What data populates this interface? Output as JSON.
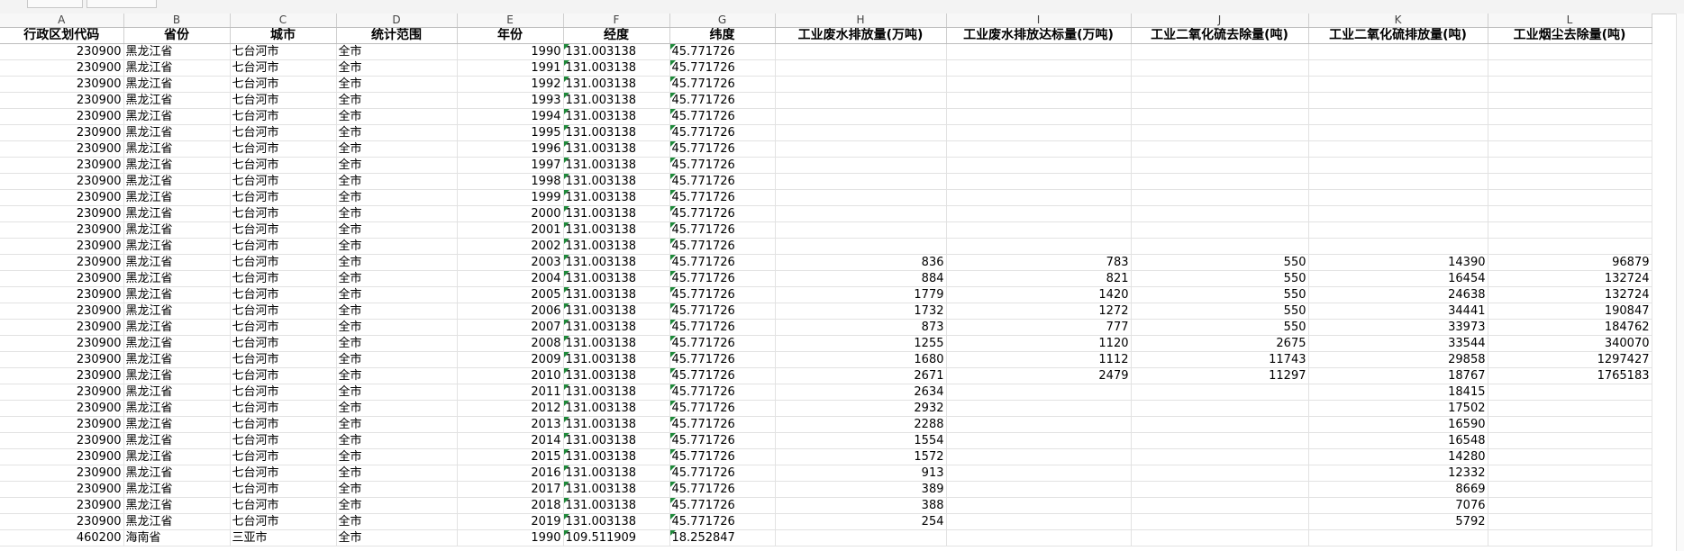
{
  "column_letters": [
    "A",
    "B",
    "C",
    "D",
    "E",
    "F",
    "G",
    "H",
    "I",
    "J",
    "K",
    "L"
  ],
  "headers": [
    "行政区划代码",
    "省份",
    "城市",
    "统计范围",
    "年份",
    "经度",
    "纬度",
    "工业废水排放量(万吨)",
    "工业废水排放达标量(万吨)",
    "工业二氧化硫去除量(吨)",
    "工业二氧化硫排放量(吨)",
    "工业烟尘去除量(吨)"
  ],
  "rows": [
    [
      "230900",
      "黑龙江省",
      "七台河市",
      "全市",
      "1990",
      "131.003138",
      "45.771726",
      "",
      "",
      "",
      "",
      ""
    ],
    [
      "230900",
      "黑龙江省",
      "七台河市",
      "全市",
      "1991",
      "131.003138",
      "45.771726",
      "",
      "",
      "",
      "",
      ""
    ],
    [
      "230900",
      "黑龙江省",
      "七台河市",
      "全市",
      "1992",
      "131.003138",
      "45.771726",
      "",
      "",
      "",
      "",
      ""
    ],
    [
      "230900",
      "黑龙江省",
      "七台河市",
      "全市",
      "1993",
      "131.003138",
      "45.771726",
      "",
      "",
      "",
      "",
      ""
    ],
    [
      "230900",
      "黑龙江省",
      "七台河市",
      "全市",
      "1994",
      "131.003138",
      "45.771726",
      "",
      "",
      "",
      "",
      ""
    ],
    [
      "230900",
      "黑龙江省",
      "七台河市",
      "全市",
      "1995",
      "131.003138",
      "45.771726",
      "",
      "",
      "",
      "",
      ""
    ],
    [
      "230900",
      "黑龙江省",
      "七台河市",
      "全市",
      "1996",
      "131.003138",
      "45.771726",
      "",
      "",
      "",
      "",
      ""
    ],
    [
      "230900",
      "黑龙江省",
      "七台河市",
      "全市",
      "1997",
      "131.003138",
      "45.771726",
      "",
      "",
      "",
      "",
      ""
    ],
    [
      "230900",
      "黑龙江省",
      "七台河市",
      "全市",
      "1998",
      "131.003138",
      "45.771726",
      "",
      "",
      "",
      "",
      ""
    ],
    [
      "230900",
      "黑龙江省",
      "七台河市",
      "全市",
      "1999",
      "131.003138",
      "45.771726",
      "",
      "",
      "",
      "",
      ""
    ],
    [
      "230900",
      "黑龙江省",
      "七台河市",
      "全市",
      "2000",
      "131.003138",
      "45.771726",
      "",
      "",
      "",
      "",
      ""
    ],
    [
      "230900",
      "黑龙江省",
      "七台河市",
      "全市",
      "2001",
      "131.003138",
      "45.771726",
      "",
      "",
      "",
      "",
      ""
    ],
    [
      "230900",
      "黑龙江省",
      "七台河市",
      "全市",
      "2002",
      "131.003138",
      "45.771726",
      "",
      "",
      "",
      "",
      ""
    ],
    [
      "230900",
      "黑龙江省",
      "七台河市",
      "全市",
      "2003",
      "131.003138",
      "45.771726",
      "836",
      "783",
      "550",
      "14390",
      "96879"
    ],
    [
      "230900",
      "黑龙江省",
      "七台河市",
      "全市",
      "2004",
      "131.003138",
      "45.771726",
      "884",
      "821",
      "550",
      "16454",
      "132724"
    ],
    [
      "230900",
      "黑龙江省",
      "七台河市",
      "全市",
      "2005",
      "131.003138",
      "45.771726",
      "1779",
      "1420",
      "550",
      "24638",
      "132724"
    ],
    [
      "230900",
      "黑龙江省",
      "七台河市",
      "全市",
      "2006",
      "131.003138",
      "45.771726",
      "1732",
      "1272",
      "550",
      "34441",
      "190847"
    ],
    [
      "230900",
      "黑龙江省",
      "七台河市",
      "全市",
      "2007",
      "131.003138",
      "45.771726",
      "873",
      "777",
      "550",
      "33973",
      "184762"
    ],
    [
      "230900",
      "黑龙江省",
      "七台河市",
      "全市",
      "2008",
      "131.003138",
      "45.771726",
      "1255",
      "1120",
      "2675",
      "33544",
      "340070"
    ],
    [
      "230900",
      "黑龙江省",
      "七台河市",
      "全市",
      "2009",
      "131.003138",
      "45.771726",
      "1680",
      "1112",
      "11743",
      "29858",
      "1297427"
    ],
    [
      "230900",
      "黑龙江省",
      "七台河市",
      "全市",
      "2010",
      "131.003138",
      "45.771726",
      "2671",
      "2479",
      "11297",
      "18767",
      "1765183"
    ],
    [
      "230900",
      "黑龙江省",
      "七台河市",
      "全市",
      "2011",
      "131.003138",
      "45.771726",
      "2634",
      "",
      "",
      "18415",
      ""
    ],
    [
      "230900",
      "黑龙江省",
      "七台河市",
      "全市",
      "2012",
      "131.003138",
      "45.771726",
      "2932",
      "",
      "",
      "17502",
      ""
    ],
    [
      "230900",
      "黑龙江省",
      "七台河市",
      "全市",
      "2013",
      "131.003138",
      "45.771726",
      "2288",
      "",
      "",
      "16590",
      ""
    ],
    [
      "230900",
      "黑龙江省",
      "七台河市",
      "全市",
      "2014",
      "131.003138",
      "45.771726",
      "1554",
      "",
      "",
      "16548",
      ""
    ],
    [
      "230900",
      "黑龙江省",
      "七台河市",
      "全市",
      "2015",
      "131.003138",
      "45.771726",
      "1572",
      "",
      "",
      "14280",
      ""
    ],
    [
      "230900",
      "黑龙江省",
      "七台河市",
      "全市",
      "2016",
      "131.003138",
      "45.771726",
      "913",
      "",
      "",
      "12332",
      ""
    ],
    [
      "230900",
      "黑龙江省",
      "七台河市",
      "全市",
      "2017",
      "131.003138",
      "45.771726",
      "389",
      "",
      "",
      "8669",
      ""
    ],
    [
      "230900",
      "黑龙江省",
      "七台河市",
      "全市",
      "2018",
      "131.003138",
      "45.771726",
      "388",
      "",
      "",
      "7076",
      ""
    ],
    [
      "230900",
      "黑龙江省",
      "七台河市",
      "全市",
      "2019",
      "131.003138",
      "45.771726",
      "254",
      "",
      "",
      "5792",
      ""
    ],
    [
      "460200",
      "海南省",
      "三亚市",
      "全市",
      "1990",
      "109.511909",
      "18.252847",
      "",
      "",
      "",
      "",
      ""
    ]
  ],
  "colors": {
    "header_border": "#bdbdbd",
    "grid": "#e2e2e2",
    "indicator": "#1e8a3a"
  }
}
